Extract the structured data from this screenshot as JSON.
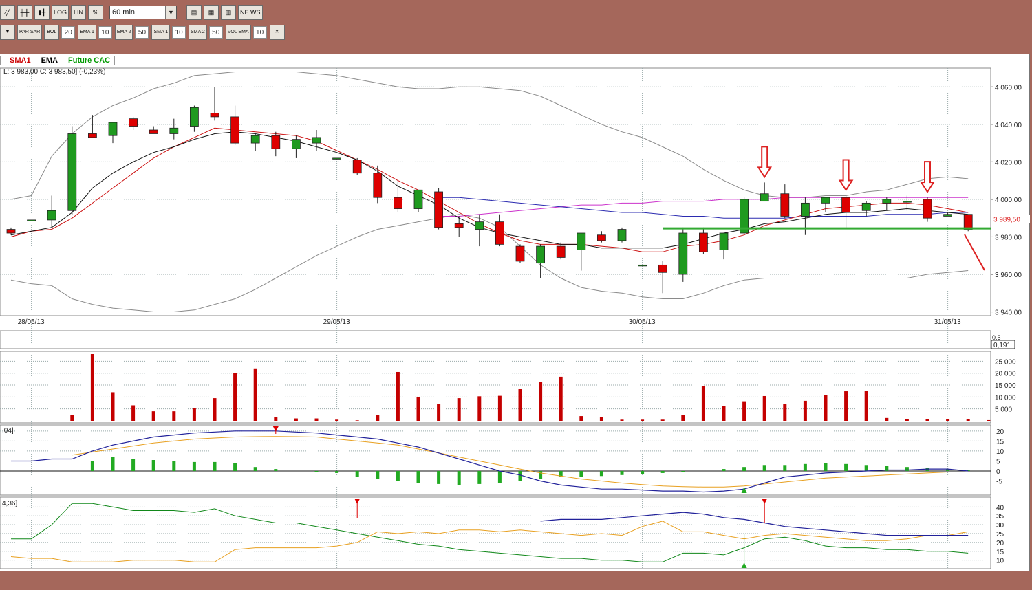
{
  "toolbar1": {
    "buttons": [
      {
        "name": "line-chart-icon",
        "label": "⁄╱"
      },
      {
        "name": "bar-chart-icon",
        "label": "╫╫"
      },
      {
        "name": "candlestick-icon",
        "label": "▮╂"
      },
      {
        "name": "log-button",
        "label": "LOG"
      },
      {
        "name": "lin-button",
        "label": "LIN"
      },
      {
        "name": "percent-button",
        "label": "%"
      }
    ],
    "timeframe": "60 min",
    "right_buttons": [
      {
        "name": "draw-tool-icon",
        "label": "▤"
      },
      {
        "name": "colors-icon",
        "label": "▦"
      },
      {
        "name": "indicator-window-icon",
        "label": "▥"
      },
      {
        "name": "news-icon",
        "label": "NE WS"
      }
    ]
  },
  "toolbar2": {
    "items": [
      {
        "name": "filter-icon",
        "label": "▼",
        "value": ""
      },
      {
        "name": "parsar-button",
        "label": "PAR SAR",
        "value": ""
      },
      {
        "name": "bol-button",
        "label": "BOL",
        "value": "20"
      },
      {
        "name": "ema1-button",
        "label": "EMA 1",
        "value": "10"
      },
      {
        "name": "ema2-button",
        "label": "EMA 2",
        "value": "50"
      },
      {
        "name": "sma1-button",
        "label": "SMA 1",
        "value": "10"
      },
      {
        "name": "sma2-button",
        "label": "SMA 2",
        "value": "50"
      },
      {
        "name": "volema-button",
        "label": "VOL EMA",
        "value": "10"
      },
      {
        "name": "chart-tool-icon",
        "label": "✕",
        "value": ""
      }
    ]
  },
  "legend": [
    {
      "label": "SMA1",
      "color": "#cc0000"
    },
    {
      "label": "EMA",
      "color": "#000000"
    },
    {
      "label": "Future CAC",
      "color": "#009900"
    }
  ],
  "info_line": "L: 3 983,00  C: 3 983,50] (-0,23%)",
  "colors": {
    "up": "#1f9a1f",
    "down": "#dd0000",
    "bollinger": "#8a8a8a",
    "sma": "#cc1111",
    "ema": "#111111",
    "sma2": "#cc33cc",
    "ema2": "#2b2bb0",
    "support": "#33aa33",
    "arrows": "#dd2222",
    "signal": "#e8a020"
  },
  "chart_data": {
    "type": "candlestick",
    "ylim": [
      3938,
      4070
    ],
    "y_ticks": [
      3940,
      3960,
      3980,
      4000,
      4020,
      4040,
      4060
    ],
    "y_tick_labels": [
      "3 940,00",
      "3 960,00",
      "3 980,00",
      "4 000,00",
      "4 020,00",
      "4 040,00",
      "4 060,00"
    ],
    "date_labels": [
      {
        "label": "28/05/13",
        "index": 1
      },
      {
        "label": "29/05/13",
        "index": 16
      },
      {
        "label": "30/05/13",
        "index": 31
      },
      {
        "label": "31/05/13",
        "index": 46
      }
    ],
    "last_price_label": "3 989,50",
    "last_price": 3989.5,
    "support_level": 3984.5,
    "candles": [
      {
        "o": 3984,
        "h": 3985,
        "l": 3981,
        "c": 3982
      },
      {
        "o": 3989,
        "h": 3989,
        "l": 3989,
        "c": 3989
      },
      {
        "o": 3989,
        "h": 4002,
        "l": 3985,
        "c": 3994
      },
      {
        "o": 3994,
        "h": 4039,
        "l": 3992,
        "c": 4035
      },
      {
        "o": 4035,
        "h": 4045,
        "l": 4033,
        "c": 4033
      },
      {
        "o": 4034,
        "h": 4041,
        "l": 4030,
        "c": 4041
      },
      {
        "o": 4043,
        "h": 4044,
        "l": 4037,
        "c": 4039
      },
      {
        "o": 4037,
        "h": 4039,
        "l": 4035,
        "c": 4035
      },
      {
        "o": 4035,
        "h": 4043,
        "l": 4032,
        "c": 4038
      },
      {
        "o": 4039,
        "h": 4050,
        "l": 4036,
        "c": 4049
      },
      {
        "o": 4046,
        "h": 4060,
        "l": 4042,
        "c": 4044
      },
      {
        "o": 4044,
        "h": 4050,
        "l": 4029,
        "c": 4030
      },
      {
        "o": 4030,
        "h": 4035,
        "l": 4026,
        "c": 4034
      },
      {
        "o": 4034,
        "h": 4036,
        "l": 4023,
        "c": 4027
      },
      {
        "o": 4027,
        "h": 4034,
        "l": 4022,
        "c": 4032
      },
      {
        "o": 4030,
        "h": 4037,
        "l": 4026,
        "c": 4033
      },
      {
        "o": 4022,
        "h": 4022,
        "l": 4022,
        "c": 4022
      },
      {
        "o": 4021,
        "h": 4022,
        "l": 4013,
        "c": 4014
      },
      {
        "o": 4014,
        "h": 4018,
        "l": 3998,
        "c": 4001
      },
      {
        "o": 4001,
        "h": 4010,
        "l": 3993,
        "c": 3995
      },
      {
        "o": 3995,
        "h": 4005,
        "l": 3993,
        "c": 4005
      },
      {
        "o": 4004,
        "h": 4006,
        "l": 3984,
        "c": 3985
      },
      {
        "o": 3987,
        "h": 3991,
        "l": 3980,
        "c": 3985
      },
      {
        "o": 3984,
        "h": 3992,
        "l": 3975,
        "c": 3988
      },
      {
        "o": 3988,
        "h": 3992,
        "l": 3975,
        "c": 3976
      },
      {
        "o": 3975,
        "h": 3976,
        "l": 3966,
        "c": 3967
      },
      {
        "o": 3966,
        "h": 3976,
        "l": 3958,
        "c": 3975
      },
      {
        "o": 3975,
        "h": 3977,
        "l": 3968,
        "c": 3969
      },
      {
        "o": 3973,
        "h": 3982,
        "l": 3962,
        "c": 3982
      },
      {
        "o": 3981,
        "h": 3983,
        "l": 3977,
        "c": 3978
      },
      {
        "o": 3978,
        "h": 3985,
        "l": 3977,
        "c": 3984
      },
      {
        "o": 3965,
        "h": 3965,
        "l": 3965,
        "c": 3965
      },
      {
        "o": 3965,
        "h": 3967,
        "l": 3950,
        "c": 3961
      },
      {
        "o": 3960,
        "h": 3985,
        "l": 3956,
        "c": 3982
      },
      {
        "o": 3982,
        "h": 3985,
        "l": 3971,
        "c": 3972
      },
      {
        "o": 3973,
        "h": 3982,
        "l": 3968,
        "c": 3982
      },
      {
        "o": 3982,
        "h": 4001,
        "l": 3981,
        "c": 4000
      },
      {
        "o": 3999,
        "h": 4009,
        "l": 3999,
        "c": 4003
      },
      {
        "o": 4003,
        "h": 4008,
        "l": 3990,
        "c": 3991
      },
      {
        "o": 3991,
        "h": 4001,
        "l": 3981,
        "c": 3998
      },
      {
        "o": 3998,
        "h": 4001,
        "l": 3993,
        "c": 4001
      },
      {
        "o": 4001,
        "h": 4002,
        "l": 3985,
        "c": 3993
      },
      {
        "o": 3994,
        "h": 3999,
        "l": 3991,
        "c": 3998
      },
      {
        "o": 3998,
        "h": 4001,
        "l": 3994,
        "c": 4000
      },
      {
        "o": 3999,
        "h": 4002,
        "l": 3994,
        "c": 3999
      },
      {
        "o": 4000,
        "h": 4001,
        "l": 3988,
        "c": 3990
      },
      {
        "o": 3991,
        "h": 3993,
        "l": 3991,
        "c": 3992
      },
      {
        "o": 3992,
        "h": 3992,
        "l": 3983,
        "c": 3984
      }
    ],
    "bollinger_upper": [
      4000,
      4002,
      4023,
      4035,
      4044,
      4050,
      4054,
      4059,
      4062,
      4066,
      4067,
      4068,
      4068,
      4068,
      4068,
      4067,
      4066,
      4064,
      4062,
      4060,
      4059,
      4059,
      4060,
      4060,
      4059,
      4058,
      4055,
      4050,
      4045,
      4040,
      4036,
      4033,
      4028,
      4023,
      4016,
      4010,
      4005,
      4002,
      4001,
      4001,
      4002,
      4002,
      4004,
      4005,
      4008,
      4011,
      4012,
      4011
    ],
    "bollinger_lower": [
      3957,
      3955,
      3954,
      3947,
      3944,
      3942,
      3941,
      3940,
      3940,
      3941,
      3944,
      3947,
      3952,
      3958,
      3964,
      3970,
      3975,
      3980,
      3984,
      3986,
      3988,
      3990,
      3992,
      3990,
      3985,
      3975,
      3965,
      3958,
      3953,
      3951,
      3950,
      3948,
      3947,
      3947,
      3950,
      3954,
      3957,
      3958,
      3958,
      3958,
      3958,
      3958,
      3958,
      3958,
      3958,
      3960,
      3961,
      3962
    ],
    "ema": [
      3981,
      3983,
      3985,
      3993,
      4006,
      4014,
      4020,
      4025,
      4028,
      4032,
      4035,
      4036,
      4035,
      4033,
      4031,
      4028,
      4025,
      4021,
      4015,
      4007,
      4002,
      3997,
      3990,
      3985,
      3982,
      3980,
      3978,
      3976,
      3976,
      3974,
      3974,
      3974,
      3974,
      3976,
      3979,
      3982,
      3984,
      3987,
      3988,
      3990,
      3992,
      3993,
      3993,
      3994,
      3995,
      3994,
      3993,
      3992
    ],
    "sma1": [
      3980,
      3983,
      3984,
      3990,
      3998,
      4006,
      4014,
      4022,
      4028,
      4033,
      4038,
      4037,
      4036,
      4035,
      4034,
      4031,
      4026,
      4021,
      4016,
      4010,
      4005,
      3999,
      3993,
      3987,
      3982,
      3978,
      3976,
      3976,
      3976,
      3975,
      3974,
      3972,
      3972,
      3975,
      3976,
      3978,
      3981,
      3986,
      3989,
      3992,
      3995,
      3996,
      3997,
      3998,
      3998,
      3997,
      3995,
      3993
    ],
    "sma2": {
      "start_index": 21,
      "values": [
        3991,
        3991,
        3992,
        3993,
        3994,
        3995,
        3996,
        3997,
        3997,
        3998,
        3998,
        3999,
        3999,
        3999,
        4000,
        4000,
        4000,
        4001,
        4001,
        4001,
        4001,
        4001,
        4001,
        4001,
        4001,
        4001,
        4001
      ]
    },
    "ema2": {
      "start_index": 21,
      "values": [
        4001,
        4001,
        4000,
        3999,
        3998,
        3997,
        3996,
        3995,
        3994,
        3993,
        3993,
        3992,
        3991,
        3991,
        3990,
        3990,
        3990,
        3990,
        3991,
        3991,
        3991,
        3991,
        3992,
        3992,
        3992,
        3993,
        3993
      ]
    },
    "rsi_label": "0,5",
    "rsi_value_label": "0,191",
    "volume": {
      "ticks": [
        5000,
        10000,
        15000,
        20000,
        25000
      ],
      "tick_labels": [
        "5 000",
        "10 000",
        "15 000",
        "20 000",
        "25 000"
      ],
      "ymax": 28000,
      "values": [
        0,
        2500,
        28000,
        12000,
        6500,
        4000,
        4000,
        5300,
        9500,
        20000,
        22000,
        1500,
        1000,
        1000,
        500,
        200,
        2500,
        20500,
        10000,
        7000,
        9500,
        10300,
        10500,
        13500,
        16200,
        18500,
        2000,
        1500,
        500,
        500,
        500,
        2500,
        14600,
        6100,
        8200,
        10400,
        7200,
        8400,
        10800,
        12400,
        12500,
        1200,
        700,
        700,
        800,
        800,
        300
      ],
      "x_start_index": 0
    },
    "macd": {
      "label": ",04]",
      "ticks": [
        -5,
        0,
        5,
        10,
        15,
        20
      ],
      "ylim": [
        -11,
        22
      ],
      "line": [
        5,
        5,
        6,
        6,
        10,
        13,
        15,
        17,
        18,
        19,
        19.5,
        20,
        20,
        20,
        19.5,
        19,
        18,
        17,
        16,
        14,
        12,
        9,
        6,
        3,
        0,
        -2,
        -5,
        -7,
        -8,
        -9,
        -9,
        -9.5,
        -10,
        -10,
        -10.5,
        -10,
        -9,
        -6,
        -3,
        -2,
        -1,
        -0.5,
        0,
        0.5,
        0.5,
        1,
        1,
        0
      ],
      "signal": {
        "start_index": 3,
        "values": [
          8,
          9.5,
          11,
          12.5,
          14,
          15,
          16,
          16.5,
          17,
          17.2,
          17.3,
          17.2,
          17,
          16,
          15,
          14,
          13,
          11,
          9,
          7,
          5,
          3,
          1,
          -1,
          -2.5,
          -4,
          -5,
          -6,
          -6.8,
          -7.5,
          -7.8,
          -8,
          -8,
          -7.5,
          -6.5,
          -5.5,
          -4.5,
          -3.5,
          -3,
          -2.5,
          -2,
          -1.5,
          -1,
          -0.5,
          -0.5
        ]
      },
      "hist": [
        0,
        0,
        0,
        0,
        5,
        7,
        6,
        5.5,
        5,
        4.5,
        4.5,
        4,
        2,
        1,
        0,
        -0.5,
        -1,
        -3,
        -4,
        -5,
        -6,
        -6.5,
        -7,
        -6.5,
        -6,
        -5,
        -4,
        -3,
        -3,
        -2.5,
        -2,
        -1.5,
        -1,
        -0.5,
        0,
        1,
        2,
        3,
        3,
        3.5,
        4,
        3.5,
        3,
        2.5,
        2,
        1.5,
        1,
        0.5
      ],
      "sell_arrow_index": 13,
      "buy_arrow_index": 36
    },
    "dmi": {
      "label": "4,36]",
      "ticks": [
        10,
        15,
        20,
        25,
        30,
        35,
        40
      ],
      "ylim": [
        6,
        44
      ],
      "green": [
        22,
        22,
        30,
        42,
        42,
        40,
        38,
        38,
        38,
        37,
        39,
        35,
        33,
        31,
        31,
        29,
        27,
        25,
        23,
        21,
        19,
        18,
        16,
        15,
        14,
        13,
        12,
        11,
        11,
        10,
        10,
        9,
        9,
        14,
        14,
        13,
        17,
        22,
        23,
        21,
        18,
        17,
        17,
        16,
        16,
        15,
        15,
        14
      ],
      "orange": [
        12,
        11,
        11,
        9,
        9,
        9,
        10,
        10,
        10,
        9,
        9,
        16,
        17,
        17,
        17,
        17,
        18,
        20,
        26,
        25,
        26,
        25,
        27,
        27,
        26,
        27,
        26,
        25,
        24,
        25,
        24,
        29,
        32,
        26,
        26,
        24,
        22,
        24,
        25,
        24,
        23,
        22,
        21,
        21,
        22,
        24,
        24,
        26
      ],
      "blue": {
        "start_index": 26,
        "values": [
          32,
          33,
          33,
          33,
          34,
          35,
          36,
          37,
          36,
          34,
          33,
          31,
          29,
          28,
          27,
          26,
          25,
          24,
          24,
          24,
          24,
          24
        ]
      },
      "sell_marker_index": 17,
      "sell_marker_index_2": 37,
      "buy_marker_index": 36
    },
    "annotations": {
      "down_arrows_indices": [
        37,
        41,
        45
      ],
      "projection_line": "downward"
    }
  }
}
